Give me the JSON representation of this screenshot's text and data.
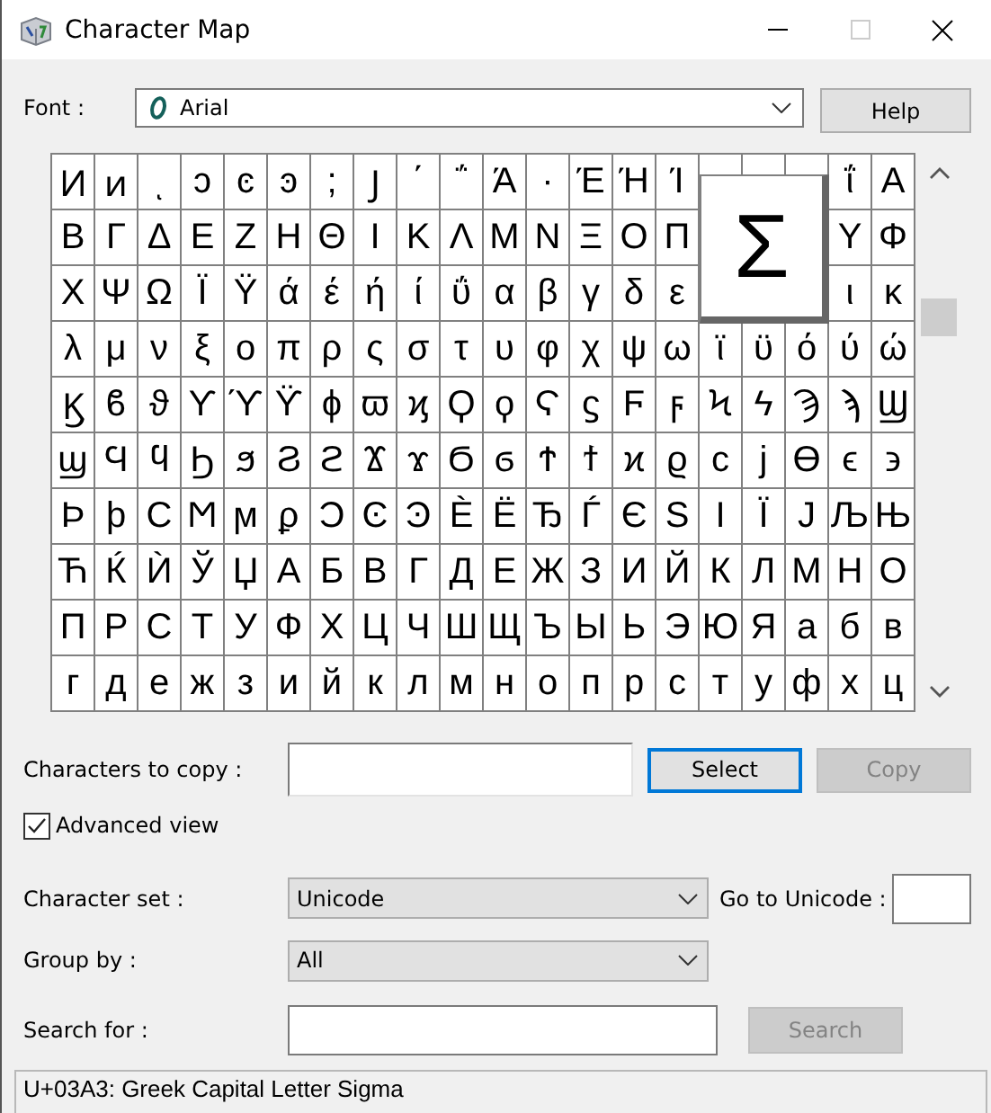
{
  "window": {
    "title": "Character Map"
  },
  "font": {
    "label": "Font :",
    "value": "Arial"
  },
  "help_button": {
    "label": "Help"
  },
  "grid": {
    "rows": [
      [
        "Ͷ",
        "ͷ",
        "ͺ",
        "ͻ",
        "ͼ",
        "ͽ",
        ";",
        "Ϳ",
        "΄",
        "΅",
        "Ά",
        "·",
        "Έ",
        "Ή",
        "Ί",
        null,
        null,
        null,
        "ΐ",
        "Α"
      ],
      [
        "Β",
        "Γ",
        "Δ",
        "Ε",
        "Ζ",
        "Η",
        "Θ",
        "Ι",
        "Κ",
        "Λ",
        "Μ",
        "Ν",
        "Ξ",
        "Ο",
        "Π",
        null,
        null,
        null,
        "Υ",
        "Φ"
      ],
      [
        "Χ",
        "Ψ",
        "Ω",
        "Ϊ",
        "Ϋ",
        "ά",
        "έ",
        "ή",
        "ί",
        "ΰ",
        "α",
        "β",
        "γ",
        "δ",
        "ε",
        null,
        null,
        null,
        "ι",
        "κ"
      ],
      [
        "λ",
        "μ",
        "ν",
        "ξ",
        "ο",
        "π",
        "ρ",
        "ς",
        "σ",
        "τ",
        "υ",
        "φ",
        "χ",
        "ψ",
        "ω",
        "ϊ",
        "ϋ",
        "ό",
        "ύ",
        "ώ"
      ],
      [
        "Ϗ",
        "ϐ",
        "ϑ",
        "ϒ",
        "ϓ",
        "ϔ",
        "ϕ",
        "ϖ",
        "ϗ",
        "Ϙ",
        "ϙ",
        "Ϛ",
        "ϛ",
        "Ϝ",
        "ϝ",
        "Ϟ",
        "ϟ",
        "Ϡ",
        "ϡ",
        "Ϣ"
      ],
      [
        "ϣ",
        "Ϥ",
        "ϥ",
        "Ϧ",
        "ϧ",
        "Ϩ",
        "ϩ",
        "Ϫ",
        "ϫ",
        "Ϭ",
        "ϭ",
        "Ϯ",
        "ϯ",
        "ϰ",
        "ϱ",
        "ϲ",
        "ϳ",
        "ϴ",
        "ϵ",
        "϶"
      ],
      [
        "Ϸ",
        "ϸ",
        "Ϲ",
        "Ϻ",
        "ϻ",
        "ϼ",
        "Ͻ",
        "Ͼ",
        "Ͽ",
        "Ѐ",
        "Ё",
        "Ђ",
        "Ѓ",
        "Є",
        "Ѕ",
        "І",
        "Ї",
        "Ј",
        "Љ",
        "Њ"
      ],
      [
        "Ћ",
        "Ќ",
        "Ѝ",
        "Ў",
        "Џ",
        "А",
        "Б",
        "В",
        "Г",
        "Д",
        "Е",
        "Ж",
        "З",
        "И",
        "Й",
        "К",
        "Л",
        "М",
        "Н",
        "О"
      ],
      [
        "П",
        "Р",
        "С",
        "Т",
        "У",
        "Ф",
        "Х",
        "Ц",
        "Ч",
        "Ш",
        "Щ",
        "Ъ",
        "Ы",
        "Ь",
        "Э",
        "Ю",
        "Я",
        "а",
        "б",
        "в"
      ],
      [
        "г",
        "д",
        "е",
        "ж",
        "з",
        "и",
        "й",
        "к",
        "л",
        "м",
        "н",
        "о",
        "п",
        "р",
        "с",
        "т",
        "у",
        "ф",
        "х",
        "ц"
      ]
    ],
    "magnified": "Σ"
  },
  "copy": {
    "label": "Characters to copy :",
    "select_button": {
      "label": "Select",
      "focused": true
    },
    "copy_button": {
      "label": "Copy",
      "disabled": true
    }
  },
  "advanced_view": {
    "label": "Advanced view",
    "checked": true
  },
  "character_set": {
    "label": "Character set :",
    "value": "Unicode"
  },
  "go_to_unicode": {
    "label": "Go to Unicode :"
  },
  "group_by": {
    "label": "Group by :",
    "value": "All"
  },
  "search": {
    "label": "Search for :",
    "button": {
      "label": "Search",
      "disabled": true
    }
  },
  "status_bar": "U+03A3: Greek Capital Letter Sigma"
}
